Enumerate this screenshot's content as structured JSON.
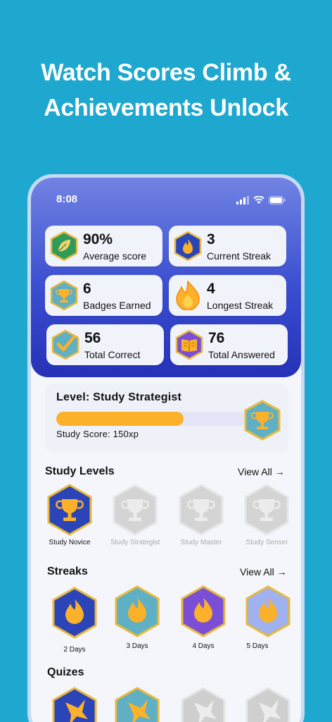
{
  "headline": {
    "line1": "Watch Scores Climb &",
    "line2": "Achievements Unlock"
  },
  "status_bar": {
    "time": "8:08"
  },
  "colors": {
    "background": "#1ea8cf",
    "hero_top": "#7183e3",
    "hero_bottom": "#2631b7",
    "progress": "#fbb12a",
    "locked": "#d4d4d4"
  },
  "stats": [
    {
      "value": "90%",
      "label": "Average score",
      "icon": "leaf-icon"
    },
    {
      "value": "3",
      "label": "Current Streak",
      "icon": "flame-icon"
    },
    {
      "value": "6",
      "label": "Badges Earned",
      "icon": "trophy-icon"
    },
    {
      "value": "4",
      "label": "Longest Streak",
      "icon": "big-flame-icon"
    },
    {
      "value": "56",
      "label": "Total Correct",
      "icon": "checkmark-icon"
    },
    {
      "value": "76",
      "label": "Total Answered",
      "icon": "book-icon"
    }
  ],
  "level": {
    "title": "Level: Study Strategist",
    "score_text": "Study Score: 150xp",
    "progress": 0.67
  },
  "study_levels": {
    "title": "Study Levels",
    "view_all": "View All →",
    "items": [
      {
        "label": "Study Novice",
        "unlocked": true
      },
      {
        "label": "Study Strategist",
        "unlocked": false
      },
      {
        "label": "Study Master",
        "unlocked": false
      },
      {
        "label": "Study Sensei",
        "unlocked": false
      }
    ]
  },
  "streaks": {
    "title": "Streaks",
    "view_all": "View All →",
    "items": [
      {
        "label": "2 Days",
        "color": "#2b44b8"
      },
      {
        "label": "3 Days",
        "color": "#5fb0c4"
      },
      {
        "label": "4 Days",
        "color": "#7a4fd6"
      },
      {
        "label": "5 Days",
        "color": "#9fb1ee"
      }
    ]
  },
  "quizzes": {
    "title": "Quizes",
    "items": [
      {
        "color": "#2b44b8",
        "unlocked": true
      },
      {
        "color": "#5fb0c4",
        "unlocked": true
      },
      {
        "color": "#cfcfcf",
        "unlocked": false
      },
      {
        "color": "#cfcfcf",
        "unlocked": false
      }
    ]
  }
}
